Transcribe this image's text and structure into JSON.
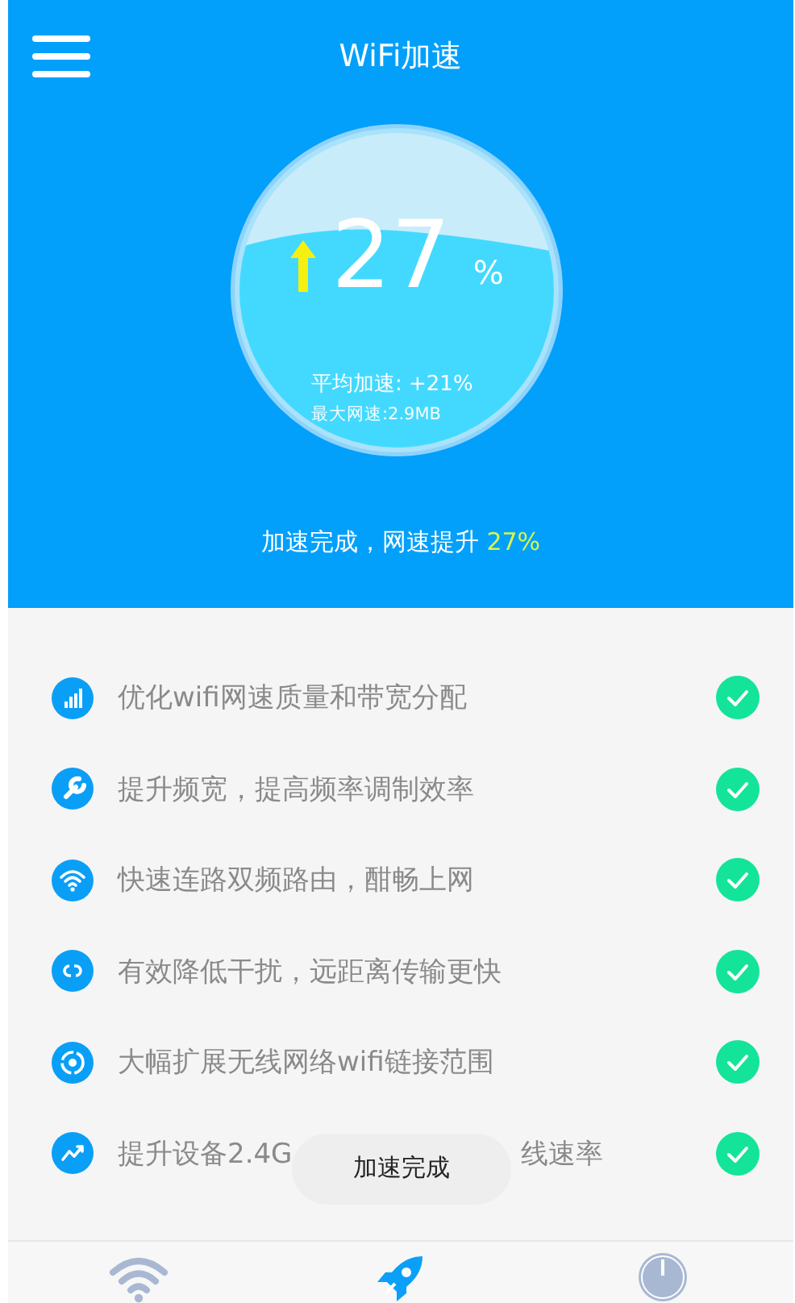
{
  "header": {
    "title": "WiFi加速"
  },
  "gauge": {
    "value": "27",
    "unit": "%",
    "average": "平均加速: +21%",
    "max_speed": "最大网速:2.9MB"
  },
  "caption": {
    "text": "加速完成，网速提升 ",
    "highlight": "27%"
  },
  "tasks": [
    {
      "kind": "signal",
      "text": "优化wifi网速质量和带宽分配",
      "done": true
    },
    {
      "kind": "wrench",
      "text": "提升频宽，提高频率调制效率",
      "done": true
    },
    {
      "kind": "wifi",
      "text": "快速连路双频路由，酣畅上网",
      "done": true
    },
    {
      "kind": "link",
      "text": "有效降低干扰，远距离传输更快",
      "done": true
    },
    {
      "kind": "cycle",
      "text": "大幅扩展无线网络wifi链接范围",
      "done": true
    },
    {
      "kind": "trend",
      "text": "提升设备2.4G",
      "text_end": "线速率",
      "done": true
    }
  ],
  "toast": {
    "text": "加速完成"
  },
  "nav": [
    {
      "kind": "wifi",
      "selected": false
    },
    {
      "kind": "rocket",
      "selected": true
    },
    {
      "kind": "gauge",
      "selected": false
    }
  ]
}
